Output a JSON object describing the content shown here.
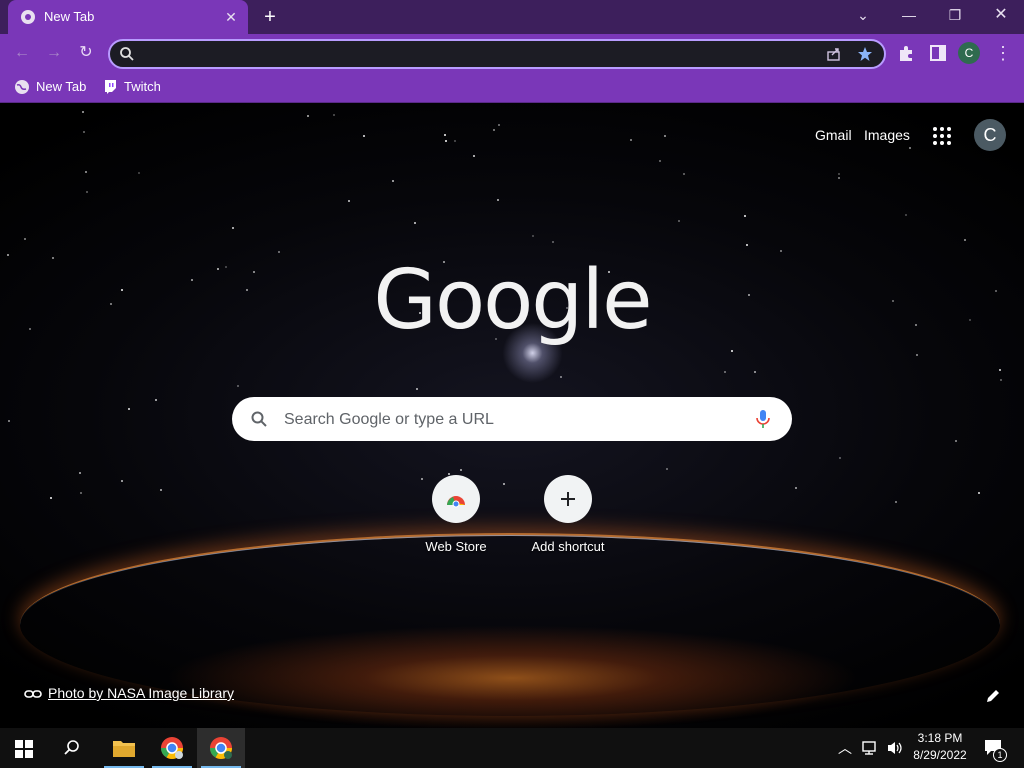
{
  "browser": {
    "tab_title": "New Tab",
    "address_value": "",
    "profile_initial": "C",
    "bookmarks": [
      {
        "label": "New Tab",
        "icon": "globe-icon"
      },
      {
        "label": "Twitch",
        "icon": "twitch-icon"
      }
    ]
  },
  "ntp": {
    "top_links": {
      "gmail": "Gmail",
      "images": "Images"
    },
    "avatar_initial": "C",
    "logo_text": "Google",
    "search_placeholder": "Search Google or type a URL",
    "shortcuts": [
      {
        "label": "Web Store",
        "icon": "chrome-web-store-icon"
      },
      {
        "label": "Add shortcut",
        "icon": "plus-icon"
      }
    ],
    "photo_credit": "Photo by NASA Image Library"
  },
  "taskbar": {
    "time": "3:18 PM",
    "date": "8/29/2022",
    "notification_count": "1"
  },
  "colors": {
    "frame": "#3d1f5c",
    "toolbar": "#7a37b8",
    "omnibox_border": "#b89cff"
  }
}
